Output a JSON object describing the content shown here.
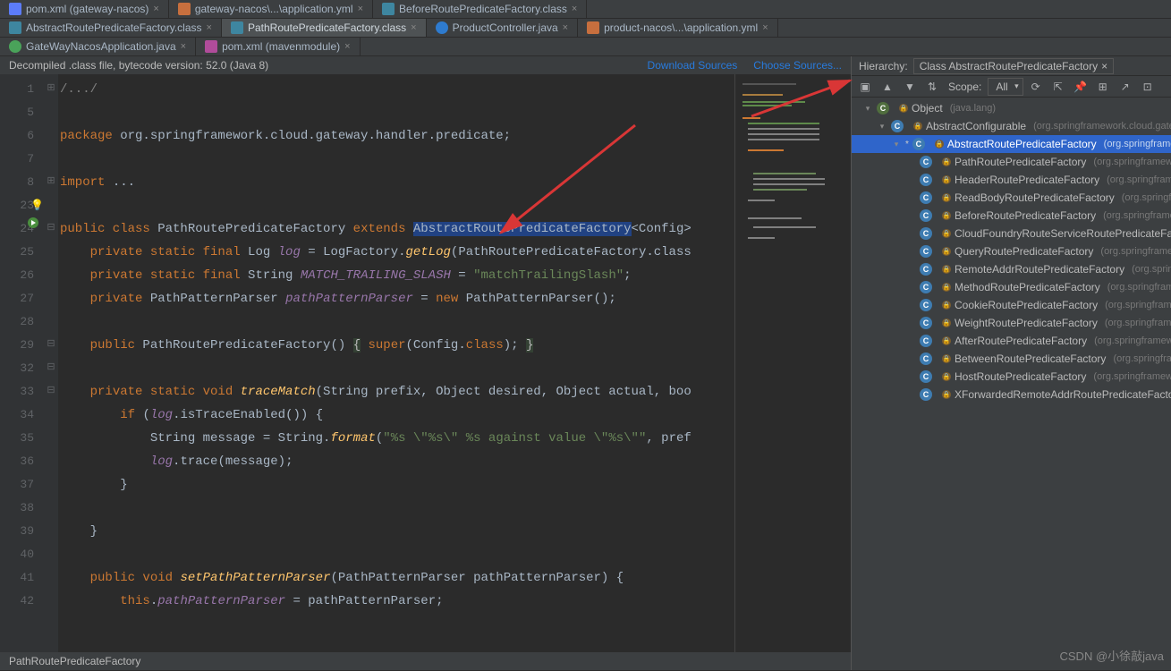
{
  "tab_rows": [
    [
      {
        "icon": "ic-xml",
        "label": "pom.xml (gateway-nacos)",
        "closable": true
      },
      {
        "icon": "ic-yml",
        "label": "gateway-nacos\\...\\application.yml",
        "closable": true
      },
      {
        "icon": "ic-class",
        "label": "BeforeRoutePredicateFactory.class",
        "closable": true
      }
    ],
    [
      {
        "icon": "ic-class",
        "label": "AbstractRoutePredicateFactory.class",
        "closable": true
      },
      {
        "icon": "ic-class",
        "label": "PathRoutePredicateFactory.class",
        "closable": true,
        "active": true
      },
      {
        "icon": "ic-java",
        "label": "ProductController.java",
        "closable": true
      },
      {
        "icon": "ic-yml",
        "label": "product-nacos\\...\\application.yml",
        "closable": true
      }
    ],
    [
      {
        "icon": "ic-go",
        "label": "GateWayNacosApplication.java",
        "closable": true
      },
      {
        "icon": "ic-maven",
        "label": "pom.xml (mavenmodule)",
        "closable": true
      }
    ]
  ],
  "info_bar": {
    "left": "Decompiled .class file, bytecode version: 52.0 (Java 8)",
    "links": [
      "Download Sources",
      "Choose Sources..."
    ]
  },
  "gutter_numbers": [
    "1",
    "5",
    "6",
    "7",
    "8",
    "23",
    "24",
    "25",
    "26",
    "27",
    "28",
    "29",
    "32",
    "33",
    "34",
    "35",
    "36",
    "37",
    "38",
    "39",
    "40",
    "41",
    "42"
  ],
  "code": {
    "l1_cmt": "/.../",
    "l2_pkg": "package",
    "l2_path": " org.springframework.cloud.gateway.handler.predicate;",
    "l3_import": "import",
    "l3_rest": " ...",
    "l4_public": "public class ",
    "l4_name": "PathRoutePredicateFactory",
    "l4_ext": " extends ",
    "l4_super": "AbstractRoutePredicateFactory",
    "l4_after": "<Config>",
    "l5": "private static final ",
    "l5b": "Log ",
    "l5f": "log",
    "l5c": " = LogFactory.",
    "l5m": "getLog",
    "l5d": "(PathRoutePredicateFactory.class",
    "l6": "private static final ",
    "l6b": "String ",
    "l6f": "MATCH_TRAILING_SLASH",
    "l6c": " = ",
    "l6s": "\"matchTrailingSlash\"",
    "l6d": ";",
    "l7": "private ",
    "l7b": "PathPatternParser ",
    "l7f": "pathPatternParser",
    "l7c": " = ",
    "l7n": "new ",
    "l7d": "PathPatternParser();",
    "l8": "public ",
    "l8b": "PathRoutePredicateFactory",
    "l8c": "() ",
    "l8bl": "{",
    "l8d": " super",
    "l8e": "(Config.",
    "l8f": "class",
    "l8g": "); ",
    "l8br": "}",
    "l9": "private static void ",
    "l9m": "traceMatch",
    "l9a": "(String prefix, Object desired, Object actual, boo",
    "l10": "if ",
    "l10b": "(",
    "l10f": "log",
    "l10c": ".isTraceEnabled()) {",
    "l11": "String message = String.",
    "l11m": "format",
    "l11a": "(",
    "l11s": "\"%s \\\"%s\\\" %s against value \\\"%s\\\"\"",
    "l11b": ", pref",
    "l12f": "log",
    "l12c": ".trace(message);",
    "l13": "}",
    "l14": "}",
    "l15": "public void ",
    "l15m": "setPathPatternParser",
    "l15a": "(PathPatternParser pathPatternParser) {",
    "l16": "this",
    "l16b": ".",
    "l16f": "pathPatternParser",
    "l16c": " = pathPatternParser;"
  },
  "breadcrumb": "PathRoutePredicateFactory",
  "hierarchy": {
    "title_label": "Hierarchy:",
    "title_value": "Class AbstractRoutePredicateFactory",
    "scope_label": "Scope:",
    "scope_value": "All",
    "items": [
      {
        "indent": 0,
        "arrow": "▾",
        "icon": "dark",
        "label": "Object",
        "pkg": "(java.lang)"
      },
      {
        "indent": 1,
        "arrow": "▾",
        "icon": "blue",
        "label": "AbstractConfigurable",
        "pkg": "(org.springframework.cloud.gate"
      },
      {
        "indent": 2,
        "arrow": "▾",
        "icon": "blue",
        "label": "AbstractRoutePredicateFactory",
        "pkg": "(org.springframew",
        "sel": true,
        "star": true
      },
      {
        "indent": 3,
        "arrow": "",
        "icon": "blue",
        "label": "PathRoutePredicateFactory",
        "pkg": "(org.springframewor"
      },
      {
        "indent": 3,
        "arrow": "",
        "icon": "blue",
        "label": "HeaderRoutePredicateFactory",
        "pkg": "(org.springframew"
      },
      {
        "indent": 3,
        "arrow": "",
        "icon": "blue",
        "label": "ReadBodyRoutePredicateFactory",
        "pkg": "(org.springfran"
      },
      {
        "indent": 3,
        "arrow": "",
        "icon": "blue",
        "label": "BeforeRoutePredicateFactory",
        "pkg": "(org.springframew"
      },
      {
        "indent": 3,
        "arrow": "",
        "icon": "blue",
        "label": "CloudFoundryRouteServiceRoutePredicateFactor",
        "pkg": ""
      },
      {
        "indent": 3,
        "arrow": "",
        "icon": "blue",
        "label": "QueryRoutePredicateFactory",
        "pkg": "(org.springframewo"
      },
      {
        "indent": 3,
        "arrow": "",
        "icon": "blue",
        "label": "RemoteAddrRoutePredicateFactory",
        "pkg": "(org.springfr"
      },
      {
        "indent": 3,
        "arrow": "",
        "icon": "blue",
        "label": "MethodRoutePredicateFactory",
        "pkg": "(org.springframe"
      },
      {
        "indent": 3,
        "arrow": "",
        "icon": "blue",
        "label": "CookieRoutePredicateFactory",
        "pkg": "(org.springframew"
      },
      {
        "indent": 3,
        "arrow": "",
        "icon": "blue",
        "label": "WeightRoutePredicateFactory",
        "pkg": "(org.springframew"
      },
      {
        "indent": 3,
        "arrow": "",
        "icon": "blue",
        "label": "AfterRoutePredicateFactory",
        "pkg": "(org.springframewo"
      },
      {
        "indent": 3,
        "arrow": "",
        "icon": "blue",
        "label": "BetweenRoutePredicateFactory",
        "pkg": "(org.springframe"
      },
      {
        "indent": 3,
        "arrow": "",
        "icon": "blue",
        "label": "HostRoutePredicateFactory",
        "pkg": "(org.springframewor"
      },
      {
        "indent": 3,
        "arrow": "",
        "icon": "blue",
        "label": "XForwardedRemoteAddrRoutePredicateFactory",
        "pkg": ""
      }
    ]
  },
  "watermark": "CSDN @小徐敲java"
}
